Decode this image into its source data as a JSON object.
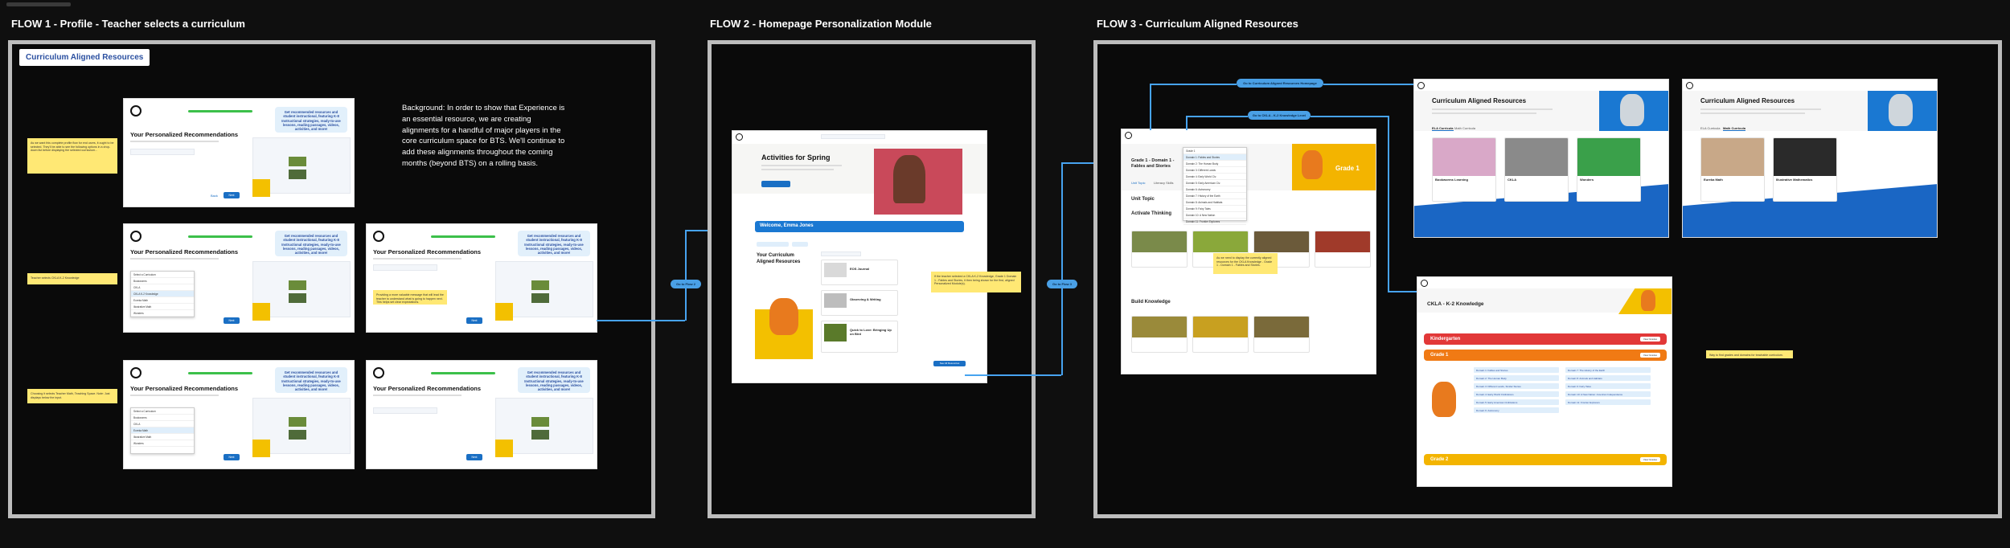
{
  "flows": [
    {
      "title": "FLOW 1 - Profile - Teacher selects a curriculum"
    },
    {
      "title": "FLOW 2  - Homepage Personalization Module"
    },
    {
      "title": "FLOW 3 - Curriculum Aligned Resources"
    }
  ],
  "flow1": {
    "label": "Curriculum Aligned Resources",
    "background_note": "Background: In order to show that Experience is an essential resource, we are creating alignments for a handful of major players in the core curriculum space for BTS. We'll continue to add these alignments throughout the coming months (beyond BTS) on a rolling basis.",
    "screen_title": "Your Personalized Recommendations",
    "bubble_text": "Get recommended resources and student instructional, featuring K-8 Instructional strategies, ready-to-use lessons, reading passages, videos, activities, and more!",
    "next_label": "Next",
    "back_label": "Back",
    "sticky_1": "As we want this complete profile flow for end users, it ought to be selected. They'll be able to see the following options in a drop-down list before displaying the selected curriculum...",
    "sticky_2": "Teacher selects CKLA K-2 Knowledge",
    "sticky_3": "Choosing it selects Teacher Math, Teaching Space. Note: Just displays below the input.",
    "sticky_4": "Providing a more valuable message that will lead the teacher to understand what is going to happen next. This helps set clear expectations."
  },
  "flow2": {
    "hero_title": "Activities for Spring",
    "welcome": "Welcome, Emma Jones",
    "module_title": "Your Curriculum Aligned Resources",
    "items": [
      "EOS Journal",
      "Observing & Writing",
      "Quick to Love: Bringing Up on Bird"
    ],
    "see_all": "See All Resources",
    "sticky": "If the teacher selected a CKLA K-2 Knowledge, Grade 1 Domain 1 - Fables and Stories, it then being shown for the first, aligned Personalized Module(s)."
  },
  "flow3": {
    "pill_1": "Go to Curriculum Aligned Resources Homepage",
    "pill_2": "Go to CKLA - K-2 Knowledge Level",
    "unit_page": {
      "breadcrumb": "CKLA K-2 Knowledge",
      "heading": "Grade 1 - Domain 1 - Fables and Stories",
      "grade_badge": "Grade 1",
      "section_1": "Activate Thinking",
      "section_2": "Build Knowledge",
      "tab_unit": "Unit Topic",
      "tab_lit": "Literacy Skills",
      "sticky": "As we need to display the currently aligned resources for the CKLA Knowledge - Grade 1 - Domain 1 - Fables and Stories."
    },
    "car_page_1": {
      "title": "Curriculum Aligned Resources",
      "tab_1": "ELA Curricula",
      "tab_2": "Math Curricula",
      "cards": [
        "Bookworms Learning",
        "CKLA",
        "Wonders"
      ]
    },
    "car_page_2": {
      "title": "Curriculum Aligned Resources",
      "tab_1": "ELA Curricula",
      "tab_2": "Math Curricula",
      "cards": [
        "Eureka Math",
        "Illustrative Mathematics"
      ]
    },
    "ckla_page": {
      "title": "CKLA - K-2 Knowledge",
      "grades": [
        "Kindergarten",
        "Grade 1",
        "Grade 2"
      ],
      "view_label": "View Grades",
      "domains": [
        "Domain 1: Fables and Stories",
        "Domain 2: The Human Body",
        "Domain 3: Different Lands, Similar Stories",
        "Domain 4: Early World Civilizations",
        "Domain 5: Early American Civilizations",
        "Domain 6: Astronomy",
        "Domain 7: The History of the Earth",
        "Domain 8: Animals and Habitats",
        "Domain 9: Fairy Tales",
        "Domain 10: A New Nation: American Independence",
        "Domain 11: Frontier Explorers"
      ],
      "sticky": "Way to find grades and domains for teachable curriculum."
    }
  }
}
